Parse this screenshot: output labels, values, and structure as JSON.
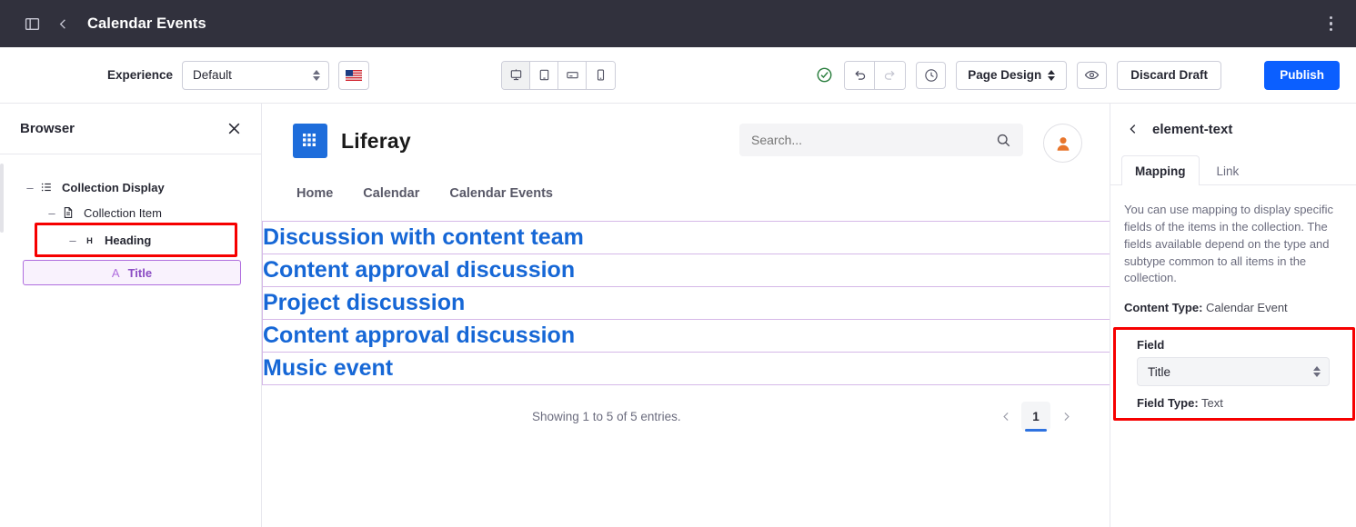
{
  "topbar": {
    "sidebar_toggle_icon": "panel-toggle-icon",
    "back_icon": "chevron-left-icon",
    "title": "Calendar Events",
    "menu_icon": "kebab-menu-icon"
  },
  "toolbar": {
    "experience_label": "Experience",
    "experience_value": "Default",
    "language_flag": "us-flag-icon",
    "devices": [
      {
        "name": "desktop",
        "icon": "desktop-icon",
        "active": true
      },
      {
        "name": "tablet",
        "icon": "tablet-icon",
        "active": false
      },
      {
        "name": "landscape",
        "icon": "tablet-landscape-icon",
        "active": false
      },
      {
        "name": "mobile",
        "icon": "mobile-icon",
        "active": false
      }
    ],
    "status_icon": "check-circle-icon",
    "undo_icon": "undo-icon",
    "redo_icon": "redo-icon",
    "history_icon": "clock-icon",
    "page_design_label": "Page Design",
    "preview_icon": "eye-icon",
    "discard_label": "Discard Draft",
    "publish_label": "Publish",
    "publish_color": "#0b5fff"
  },
  "sidebar": {
    "title": "Browser",
    "close_icon": "close-icon",
    "tree": [
      {
        "label": "Collection Display",
        "icon": "list-icon",
        "level": 0,
        "bold": true
      },
      {
        "label": "Collection Item",
        "icon": "document-icon",
        "level": 1,
        "bold": false
      },
      {
        "label": "Heading",
        "icon": "heading-icon",
        "level": 2,
        "bold": true,
        "annotated": true
      }
    ],
    "selected_chip": {
      "label": "Title",
      "icon": "text-icon",
      "color": "#8b4cc4"
    }
  },
  "canvas": {
    "brand_name": "Liferay",
    "brand_icon": "liferay-logo-icon",
    "search_placeholder": "Search...",
    "search_value": "",
    "search_icon": "search-icon",
    "avatar_icon": "user-avatar-icon",
    "nav": [
      {
        "label": "Home"
      },
      {
        "label": "Calendar"
      },
      {
        "label": "Calendar Events"
      }
    ],
    "entries": [
      {
        "title": "Discussion with content team"
      },
      {
        "title": "Content approval discussion"
      },
      {
        "title": "Project discussion"
      },
      {
        "title": "Content approval discussion"
      },
      {
        "title": "Music event"
      }
    ],
    "entry_color": "#1667d6",
    "entry_border_color": "#d5b8e8",
    "showing_text": "Showing 1 to 5 of 5 entries.",
    "pager": {
      "prev_icon": "chevron-left-icon",
      "next_icon": "chevron-right-icon",
      "current_page": "1"
    }
  },
  "rightpanel": {
    "back_icon": "chevron-left-icon",
    "title": "element-text",
    "tabs": [
      {
        "label": "Mapping",
        "active": true
      },
      {
        "label": "Link",
        "active": false
      }
    ],
    "description": "You can use mapping to display specific fields of the items in the collection. The fields available depend on the type and subtype common to all items in the collection.",
    "content_type_label": "Content Type:",
    "content_type_value": "Calendar Event",
    "field_label": "Field",
    "field_value": "Title",
    "field_type_label": "Field Type:",
    "field_type_value": "Text",
    "annotation_color": "#f60000"
  }
}
